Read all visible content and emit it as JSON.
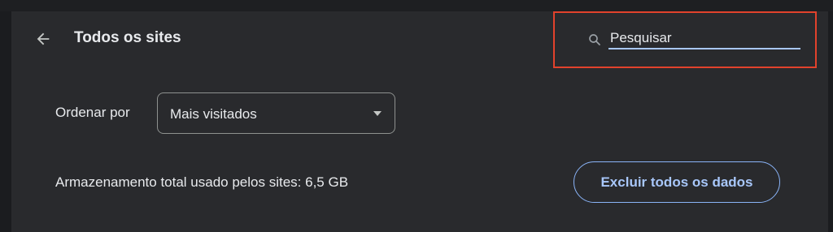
{
  "header": {
    "back_icon": "arrow-left-icon",
    "title": "Todos os sites"
  },
  "search": {
    "icon": "search-icon",
    "placeholder": "Pesquisar",
    "value": "",
    "highlight_color": "#e2422c",
    "underline_color": "#a8c7fa"
  },
  "sort": {
    "label": "Ordenar por",
    "selected": "Mais visitados",
    "dropdown_icon": "triangle-down-icon"
  },
  "storage": {
    "text": "Armazenamento total usado pelos sites: 6,5 GB"
  },
  "actions": {
    "clear_all_label": "Excluir todos os dados",
    "accent_color": "#8ab4f8"
  },
  "colors": {
    "background": "#292a2d",
    "text": "#e8eaed"
  }
}
